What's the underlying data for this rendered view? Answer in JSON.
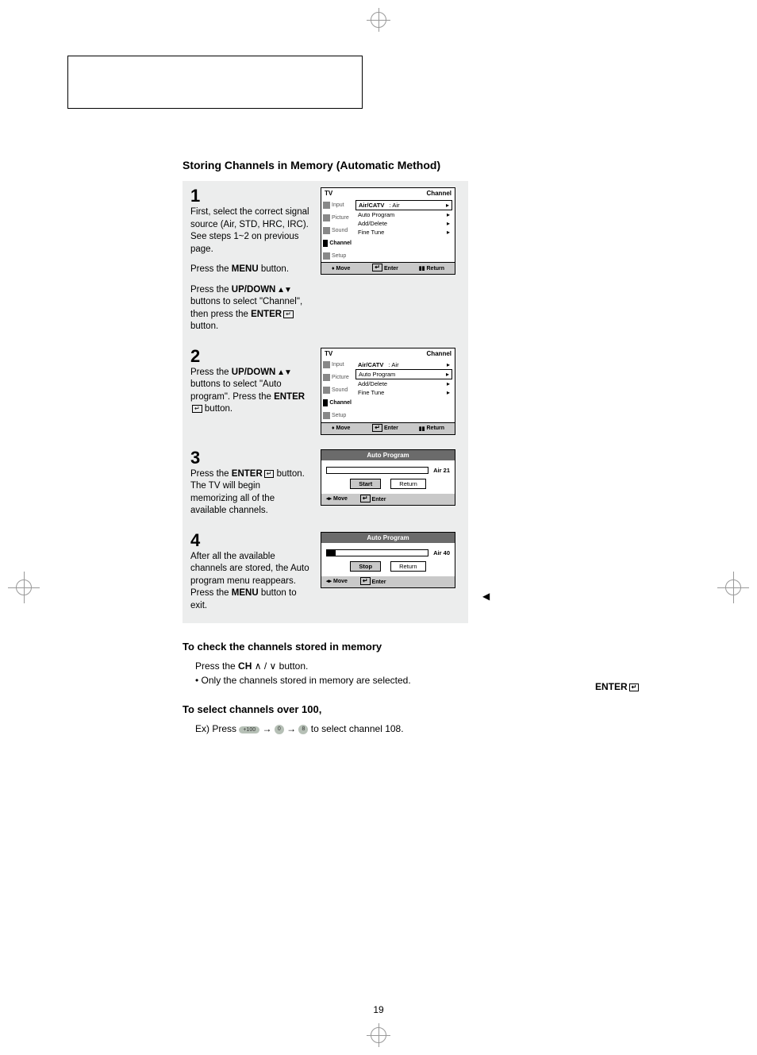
{
  "page_number": "19",
  "section_title": "Storing Channels in Memory (Automatic Method)",
  "steps": {
    "s1": {
      "num": "1",
      "p1": "First, select the correct signal source (Air, STD, HRC, IRC). See steps 1~2 on previous page.",
      "p2_pre": "Press the ",
      "p2_menu": "MENU",
      "p2_post": " button.",
      "p3_pre": "Press the ",
      "p3_updown": "UP/DOWN",
      "p3_mid": " buttons to select \"Channel\", then press the ",
      "p3_enter": "ENTER",
      "p3_post": " button."
    },
    "s2": {
      "num": "2",
      "p1_pre": "Press the ",
      "p1_updown": "UP/DOWN",
      "p1_mid": " buttons to select \"Auto program\". Press the ",
      "p1_enter": "ENTER",
      "p1_post": " button."
    },
    "s3": {
      "num": "3",
      "p1_pre": "Press the ",
      "p1_enter": "ENTER",
      "p1_post": " button.",
      "p2": "The TV will begin memorizing all of the available channels."
    },
    "s4": {
      "num": "4",
      "p1": "After all the available channels are stored, the Auto program menu reappears.",
      "p2_pre": "Press the ",
      "p2_menu": "MENU",
      "p2_post": " button to exit."
    }
  },
  "osd_common": {
    "tv": "TV",
    "channel_title": "Channel",
    "side": {
      "input": "Input",
      "picture": "Picture",
      "sound": "Sound",
      "channel": "Channel",
      "setup": "Setup"
    },
    "rows": {
      "aircatv": "Air/CATV",
      "aircatv_val": ": Air",
      "auto_program": "Auto Program",
      "add_delete": "Add/Delete",
      "fine_tune": "Fine Tune"
    },
    "footer": {
      "move": "Move",
      "enter": "Enter",
      "return": "Return"
    }
  },
  "auto1": {
    "title": "Auto Program",
    "label": "Air 21",
    "btn_start": "Start",
    "btn_return": "Return",
    "foot_move": "Move",
    "foot_enter": "Enter"
  },
  "auto2": {
    "title": "Auto Program",
    "label": "Air 40",
    "btn_stop": "Stop",
    "btn_return": "Return",
    "foot_move": "Move",
    "foot_enter": "Enter"
  },
  "right_enter": "ENTER",
  "side_marker": "◀",
  "check_heading": "To check the channels stored in memory",
  "check_line_pre": "Press the ",
  "check_ch": "CH",
  "check_line_post": " button.",
  "check_bullet": "Only the channels stored in memory are selected.",
  "over100_heading": "To select channels over 100,",
  "over100_pre": "Ex) Press ",
  "over100_mid1": " → ",
  "over100_mid2": " → ",
  "over100_post": " to select channel 108.",
  "key100": "+100",
  "key0": "0",
  "key8": "8",
  "ch_up": "∧",
  "ch_down": "∨",
  "enter_glyph": "↵"
}
